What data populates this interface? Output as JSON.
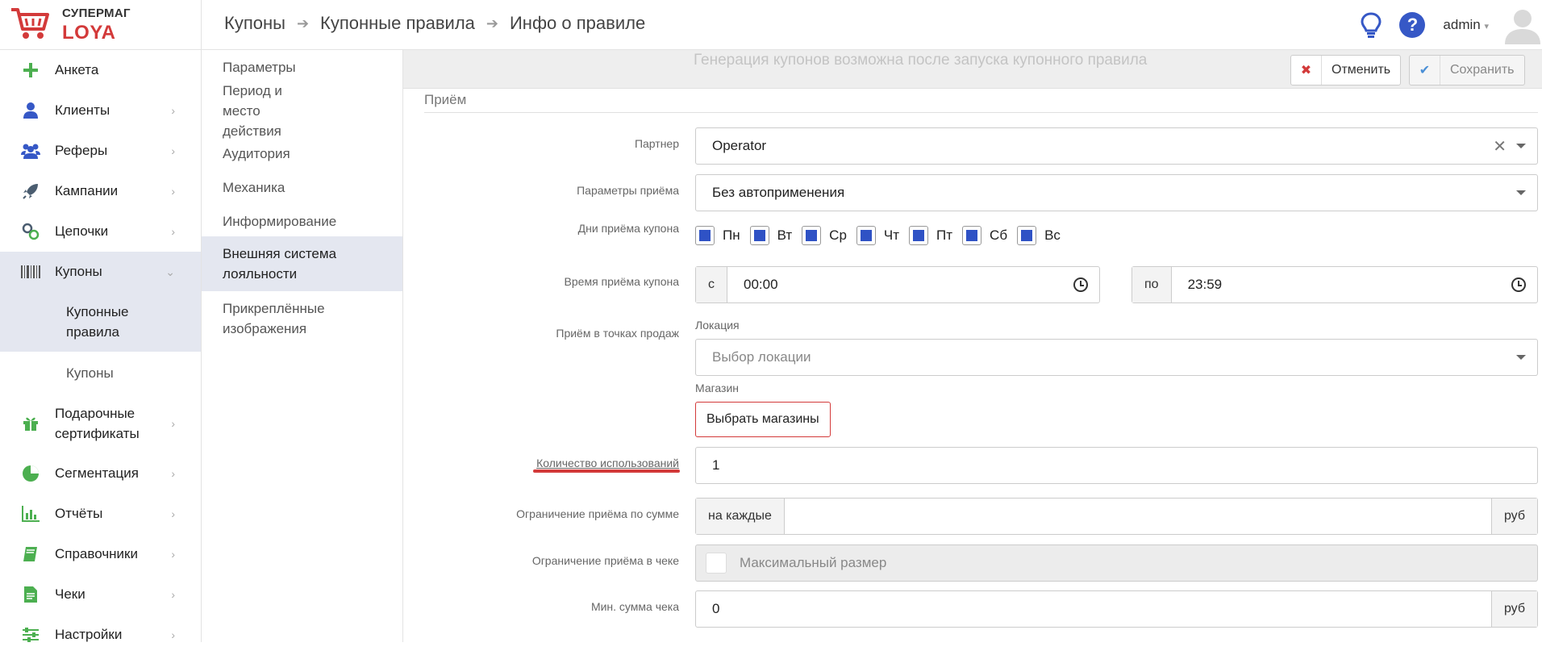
{
  "logo": {
    "top": "СУПЕРМАГ",
    "bottom": "LOYA"
  },
  "breadcrumb": [
    "Купоны",
    "Купонные правила",
    "Инфо о правиле"
  ],
  "header": {
    "user": "admin",
    "help": "?"
  },
  "sidebar": {
    "items": [
      {
        "label": "Анкета"
      },
      {
        "label": "Клиенты"
      },
      {
        "label": "Реферы"
      },
      {
        "label": "Кампании"
      },
      {
        "label": "Цепочки"
      },
      {
        "label": "Купоны"
      },
      {
        "label": "Подарочные сертификаты"
      },
      {
        "label": "Сегментация"
      },
      {
        "label": "Отчёты"
      },
      {
        "label": "Справочники"
      },
      {
        "label": "Чеки"
      },
      {
        "label": "Настройки"
      }
    ],
    "sub": [
      {
        "label": "Купонные правила"
      },
      {
        "label": "Купоны"
      }
    ]
  },
  "subnav": [
    {
      "label": "Параметры"
    },
    {
      "label": "Период и место действия"
    },
    {
      "label": "Аудитория"
    },
    {
      "label": "Механика"
    },
    {
      "label": "Информирование"
    },
    {
      "label": "Внешняя система лояльности"
    },
    {
      "label": "Прикреплённые изображения"
    }
  ],
  "toolbar": {
    "ghost_text": "Генерация купонов возможна после запуска купонного правила",
    "cancel": "Отменить",
    "save": "Сохранить"
  },
  "form": {
    "section": "Приём",
    "partner": {
      "label": "Партнер",
      "value": "Operator"
    },
    "params": {
      "label": "Параметры приёма",
      "value": "Без автоприменения"
    },
    "days": {
      "label": "Дни приёма купона",
      "values": [
        "Пн",
        "Вт",
        "Ср",
        "Чт",
        "Пт",
        "Сб",
        "Вс"
      ]
    },
    "time": {
      "label": "Время приёма купона",
      "from_prefix": "с",
      "from": "00:00",
      "to_prefix": "по",
      "to": "23:59"
    },
    "points": {
      "label": "Приём в точках продаж",
      "location_label": "Локация",
      "location_placeholder": "Выбор локации",
      "shop_label": "Магазин",
      "shop_button": "Выбрать магазины"
    },
    "usage": {
      "label": "Количество использований",
      "value": "1"
    },
    "sum_limit": {
      "label": "Ограничение приёма по сумме",
      "prefix": "на каждые",
      "value": "",
      "suffix": "руб"
    },
    "check_limit": {
      "label": "Ограничение приёма в чеке",
      "placeholder": "Максимальный размер"
    },
    "min_sum": {
      "label": "Мин. сумма чека",
      "value": "0",
      "suffix": "руб"
    }
  },
  "colors": {
    "accent": "#d33a3a",
    "brand_blue": "#2f52c5",
    "active_bg": "#e4e7f0"
  }
}
